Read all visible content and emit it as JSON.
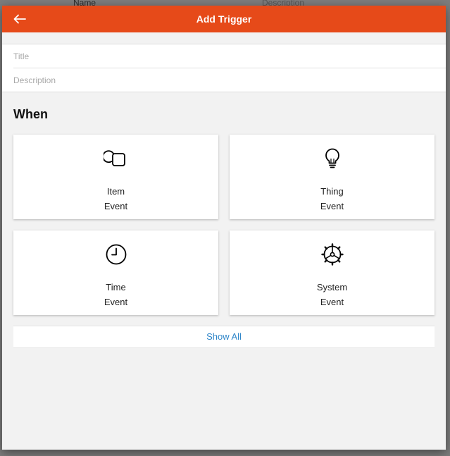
{
  "background": {
    "col_name": "Name",
    "col_description": "Description"
  },
  "navbar": {
    "title": "Add Trigger",
    "back_icon": "arrow-left-icon",
    "color": "#e64a19"
  },
  "form": {
    "title_placeholder": "Title",
    "title_value": "",
    "description_placeholder": "Description",
    "description_value": ""
  },
  "section": {
    "heading": "When"
  },
  "cards": [
    {
      "icon": "item-squares-icon",
      "line1": "Item",
      "line2": "Event"
    },
    {
      "icon": "lightbulb-icon",
      "line1": "Thing",
      "line2": "Event"
    },
    {
      "icon": "clock-icon",
      "line1": "Time",
      "line2": "Event"
    },
    {
      "icon": "gear-icon",
      "line1": "System",
      "line2": "Event"
    }
  ],
  "show_all": {
    "label": "Show All",
    "color": "#2f86c9"
  }
}
